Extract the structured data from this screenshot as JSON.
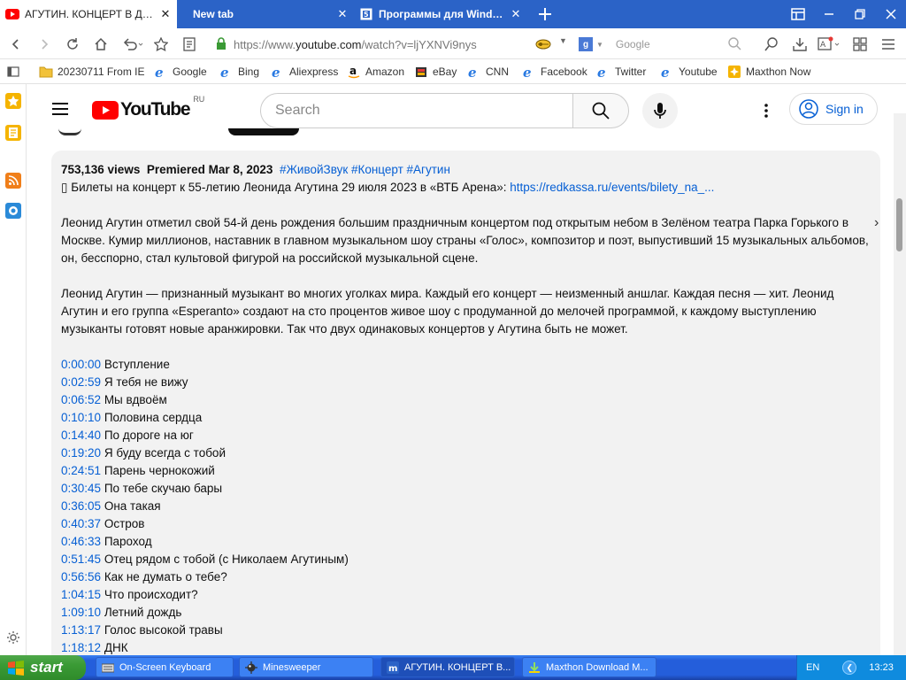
{
  "browser": {
    "tabs": [
      {
        "label": "АГУТИН. КОНЦЕРТ В ДЕН",
        "active": true,
        "icon": "youtube-icon"
      },
      {
        "label": "New tab",
        "active": false
      },
      {
        "label": "Программы для Windows",
        "active": false,
        "icon": "page-icon"
      }
    ],
    "url_prefix": "https://www.",
    "url_domain": "youtube.com",
    "url_path": "/watch?v=ljYXNVi9nys",
    "search_engine_placeholder": "Google",
    "bookmarks": [
      {
        "label": "20230711 From IE",
        "icon": "folder-icon"
      },
      {
        "label": "Google",
        "icon": "ie-icon"
      },
      {
        "label": "Bing",
        "icon": "ie-icon"
      },
      {
        "label": "Aliexpress",
        "icon": "ie-icon"
      },
      {
        "label": "Amazon",
        "icon": "amazon-icon"
      },
      {
        "label": "eBay",
        "icon": "ebay-icon"
      },
      {
        "label": "CNN",
        "icon": "ie-icon"
      },
      {
        "label": "Facebook",
        "icon": "ie-icon"
      },
      {
        "label": "Twitter",
        "icon": "ie-icon"
      },
      {
        "label": "Youtube",
        "icon": "ie-icon"
      },
      {
        "label": "Maxthon Now",
        "icon": "maxthon-icon"
      }
    ]
  },
  "youtube": {
    "logo_text": "YouTube",
    "region": "RU",
    "search_placeholder": "Search",
    "sign_in": "Sign in"
  },
  "description": {
    "views": "753,136 views",
    "premiered": "Premiered Mar 8, 2023",
    "tags": "#ЖивойЗвук #Концерт #Агутин",
    "tickets_text": "Билеты на концерт к 55-летию Леонида Агутина 29 июля 2023 в «ВТБ Арена»:",
    "tickets_link": "https://redkassa.ru/events/bilety_na_...",
    "para1": "Леонид Агутин отметил свой 54-й день рождения большим праздничным концертом под открытым небом в Зелёном театра Парка Горького в Москве. Кумир миллионов, наставник в главном музыкальном шоу страны «Голос», композитор и поэт, выпустивший 15 музыкальных альбомов, он, бесспорно, стал культовой фигурой на российской музыкальной сцене.",
    "para2": "Леонид Агутин — признанный музыкант во многих уголках мира. Каждый его концерт — неизменный аншлаг. Каждая песня — хит. Леонид Агутин и его группа «Esperanto» создают на сто процентов живое шоу с продуманной до мелочей программой, к каждому выступлению музыканты готовят новые аранжировки. Так что двух одинаковых концертов у Агутина быть не может.",
    "chapters": [
      {
        "time": "0:00:00",
        "title": "Вступление"
      },
      {
        "time": "0:02:59",
        "title": "Я тебя не вижу"
      },
      {
        "time": "0:06:52",
        "title": "Мы вдвоём"
      },
      {
        "time": "0:10:10",
        "title": "Половина сердца"
      },
      {
        "time": "0:14:40",
        "title": "По дороге на юг"
      },
      {
        "time": "0:19:20",
        "title": "Я буду всегда с тобой"
      },
      {
        "time": "0:24:51",
        "title": "Парень чернокожий"
      },
      {
        "time": "0:30:45",
        "title": "По тебе скучаю бары"
      },
      {
        "time": "0:36:05",
        "title": "Она такая"
      },
      {
        "time": "0:40:37",
        "title": "Остров"
      },
      {
        "time": "0:46:33",
        "title": "Пароход"
      },
      {
        "time": "0:51:45",
        "title": "Отец рядом с тобой (с Николаем Агутиным)"
      },
      {
        "time": "0:56:56",
        "title": "Как не думать о тебе?"
      },
      {
        "time": "1:04:15",
        "title": "Что происходит?"
      },
      {
        "time": "1:09:10",
        "title": "Летний дождь"
      },
      {
        "time": "1:13:17",
        "title": "Голос высокой травы"
      },
      {
        "time": "1:18:12",
        "title": "ДНК"
      }
    ]
  },
  "taskbar": {
    "start_label": "start",
    "items": [
      {
        "label": "On-Screen Keyboard",
        "icon": "keyboard-icon",
        "active": false
      },
      {
        "label": "Minesweeper",
        "icon": "minesweeper-icon",
        "active": false
      },
      {
        "label": "АГУТИН. КОНЦЕРТ В...",
        "icon": "maxthon-icon",
        "active": true
      },
      {
        "label": "Maxthon Download M...",
        "icon": "download-icon",
        "active": false
      }
    ],
    "lang": "EN",
    "clock": "13:23"
  },
  "colors": {
    "tab_bar": "#2b63c7",
    "link": "#065fd4",
    "youtube_red": "#ff0000",
    "taskbar": "#245edb",
    "start": "#3a9a35"
  }
}
